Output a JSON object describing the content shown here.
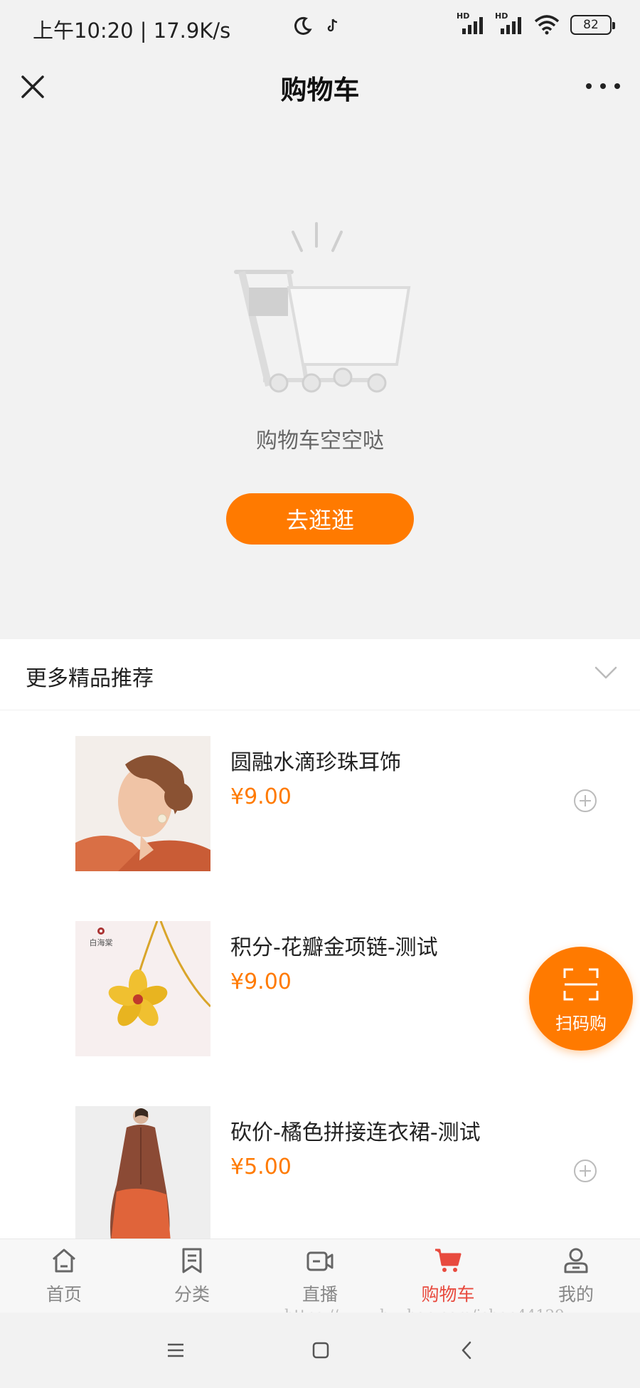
{
  "status_bar": {
    "time_speed": "上午10:20 | 17.9K/s",
    "signal1_label": "HD",
    "signal2_label": "HD",
    "battery": "82"
  },
  "nav": {
    "title": "购物车"
  },
  "empty_cart": {
    "message": "购物车空空哒",
    "button_label": "去逛逛"
  },
  "recommend": {
    "title": "更多精品推荐",
    "products": [
      {
        "name": "圆融水滴珍珠耳饰",
        "price": "¥9.00"
      },
      {
        "name": "积分-花瓣金项链-测试",
        "price": "¥9.00",
        "brand_mark": "白海棠"
      },
      {
        "name": "砍价-橘色拼接连衣裙-测试",
        "price": "¥5.00"
      }
    ]
  },
  "scan_button": {
    "label": "扫码购"
  },
  "tabs": [
    {
      "label": "首页",
      "icon": "home-icon"
    },
    {
      "label": "分类",
      "icon": "category-icon"
    },
    {
      "label": "直播",
      "icon": "live-icon"
    },
    {
      "label": "购物车",
      "icon": "cart-icon",
      "active": true
    },
    {
      "label": "我的",
      "icon": "profile-icon"
    }
  ],
  "watermark": "https://www.huzhan.com/ishop44129",
  "colors": {
    "accent": "#ff7a00",
    "active_tab": "#e84a3e",
    "background": "#f2f2f2"
  }
}
